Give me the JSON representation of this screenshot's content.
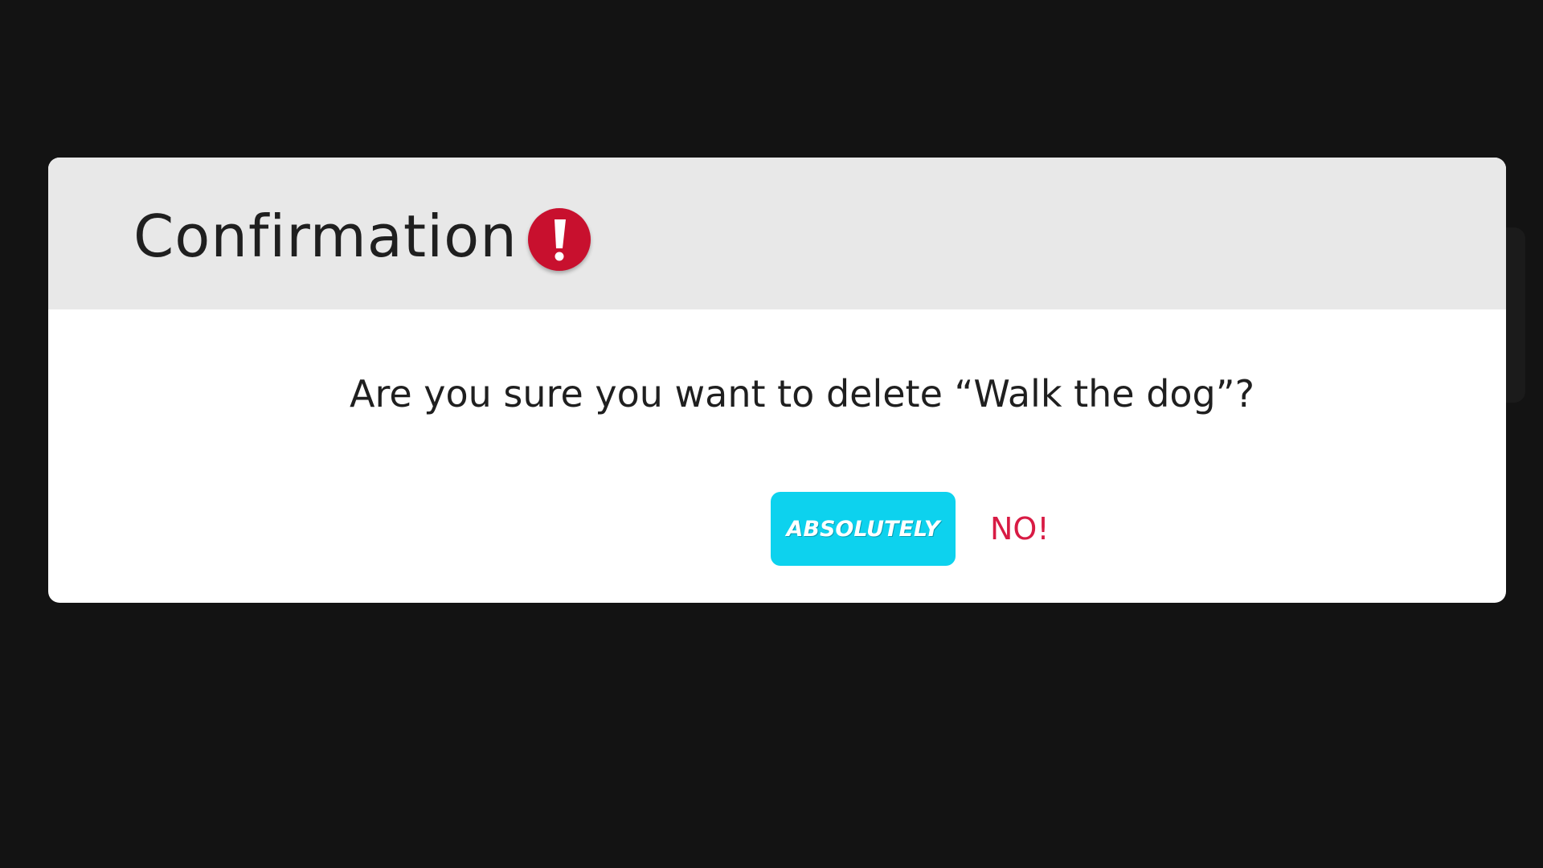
{
  "dialog": {
    "title": "Confirmation",
    "icon": "exclamation-icon",
    "icon_color": "#c8102e",
    "message": "Are you sure you want to delete “Walk the dog”?",
    "confirm_label": "ABSOLUTELY",
    "confirm_color": "#0dd2ee",
    "cancel_label": "NO!",
    "cancel_color": "#d81b44"
  }
}
